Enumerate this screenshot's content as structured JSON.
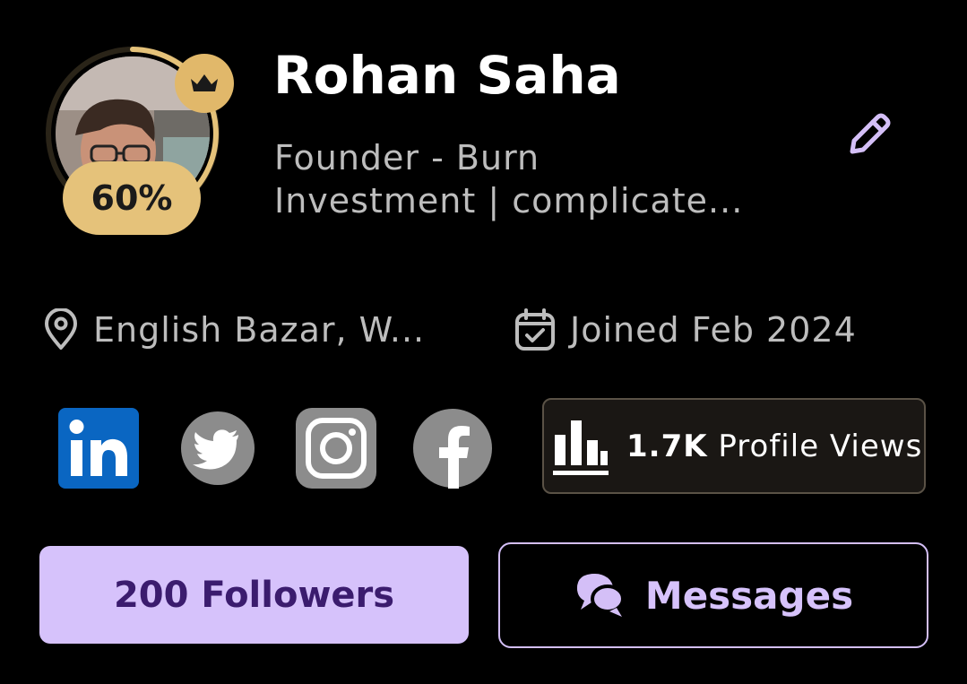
{
  "profile": {
    "name": "Rohan Saha",
    "headline_line1": "Founder - Burn",
    "headline_line2": "Investment | complicate...",
    "completion": "60%",
    "location": "English Bazar, W...",
    "joined": "Joined Feb 2024"
  },
  "stats": {
    "views_count": "1.7K",
    "views_label": "Profile Views"
  },
  "actions": {
    "followers_label": "200 Followers",
    "messages_label": "Messages"
  },
  "icons": {
    "crown": "crown-icon",
    "edit": "pencil-icon",
    "location": "map-pin-icon",
    "calendar": "calendar-check-icon",
    "linkedin": "linkedin-icon",
    "twitter": "twitter-icon",
    "instagram": "instagram-icon",
    "facebook": "facebook-icon",
    "views": "bar-chart-icon",
    "messages": "chat-bubbles-icon"
  },
  "colors": {
    "background": "#000000",
    "gold": "#e5c27a",
    "accent_purple": "#d6c2fb",
    "accent_purple_dark": "#3b1c6e",
    "muted_text": "#bdbdbd",
    "linkedin_blue": "#0a66c2",
    "social_gray": "#8c8c8c"
  }
}
